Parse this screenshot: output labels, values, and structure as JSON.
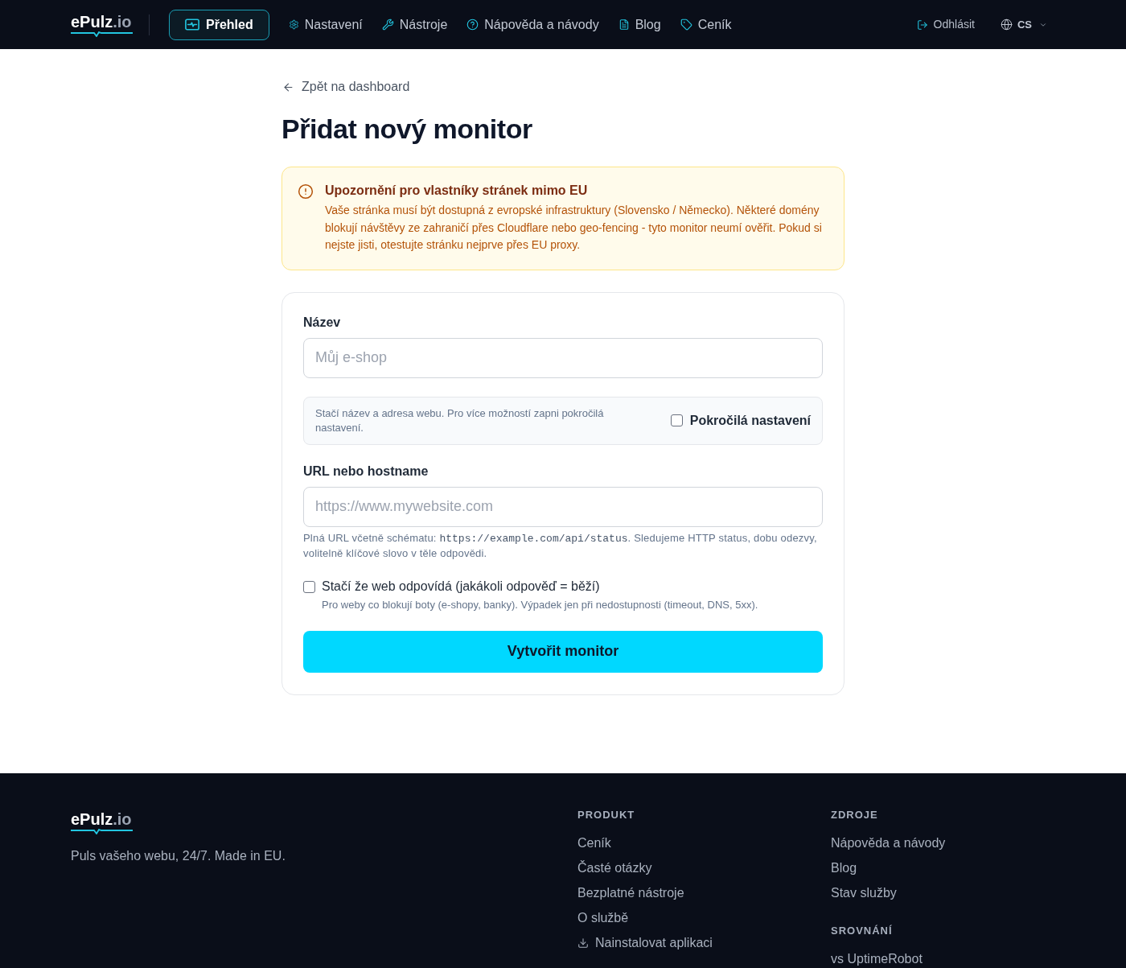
{
  "header": {
    "logo": {
      "name": "ePulz",
      "suffix": ".io"
    },
    "nav": [
      {
        "label": "Přehled",
        "selected": true
      },
      {
        "label": "Nastavení",
        "selected": false
      },
      {
        "label": "Nástroje",
        "selected": false
      },
      {
        "label": "Nápověda a návody",
        "selected": false
      },
      {
        "label": "Blog",
        "selected": false
      },
      {
        "label": "Ceník",
        "selected": false
      }
    ],
    "logout": "Odhlásit",
    "language": "CS"
  },
  "back_link": "Zpět na dashboard",
  "title": "Přidat nový monitor",
  "alert": {
    "title": "Upozornění pro vlastníky stránek mimo EU",
    "text": "Vaše stránka musí být dostupná z evropské infrastruktury (Slovensko / Německo). Některé domény blokují návštěvy ze zahraničí přes Cloudflare nebo geo-fencing - tyto monitor neumí ověřit. Pokud si nejste jisti, otestujte stránku nejprve přes EU proxy."
  },
  "form": {
    "name_field": {
      "label": "Název",
      "placeholder": "Můj e-shop"
    },
    "advanced": {
      "hint": "Stačí název a adresa webu. Pro více možností zapni pokročilá nastavení.",
      "label": "Pokročilá nastavení",
      "checked": false
    },
    "url_field": {
      "label": "URL nebo hostname",
      "placeholder": "https://www.mywebsite.com",
      "help": {
        "before": "Plná URL včetně schématu: ",
        "code": "https://example.com/api/status",
        "after": ". Sledujeme HTTP status, dobu odezvy, volitelně klíčové slovo v těle odpovědi."
      }
    },
    "any_response": {
      "label": "Stačí že web odpovídá (jakákoli odpověď = běží)",
      "description": "Pro weby co blokují boty (e-shopy, banky). Výpadek jen při nedostupnosti (timeout, DNS, 5xx).",
      "checked": false
    },
    "submit": "Vytvořit monitor"
  },
  "footer": {
    "logo": {
      "name": "ePulz",
      "suffix": ".io"
    },
    "tagline": "Puls vašeho webu, 24/7. Made in EU.",
    "columns": [
      {
        "sections": [
          {
            "heading": "PRODUKT",
            "links": [
              {
                "label": "Ceník",
                "kind": "link"
              },
              {
                "label": "Časté otázky",
                "kind": "link"
              },
              {
                "label": "Bezplatné nástroje",
                "kind": "link"
              },
              {
                "label": "O službě",
                "kind": "link"
              },
              {
                "label": "Nainstalovat aplikaci",
                "kind": "download"
              }
            ]
          }
        ]
      },
      {
        "sections": [
          {
            "heading": "ZDROJE",
            "links": [
              {
                "label": "Nápověda a návody",
                "kind": "link"
              },
              {
                "label": "Blog",
                "kind": "link"
              },
              {
                "label": "Stav služby",
                "kind": "link"
              }
            ]
          },
          {
            "heading": "SROVNÁNÍ",
            "links": [
              {
                "label": "vs UptimeRobot",
                "kind": "link"
              }
            ]
          }
        ]
      }
    ]
  }
}
